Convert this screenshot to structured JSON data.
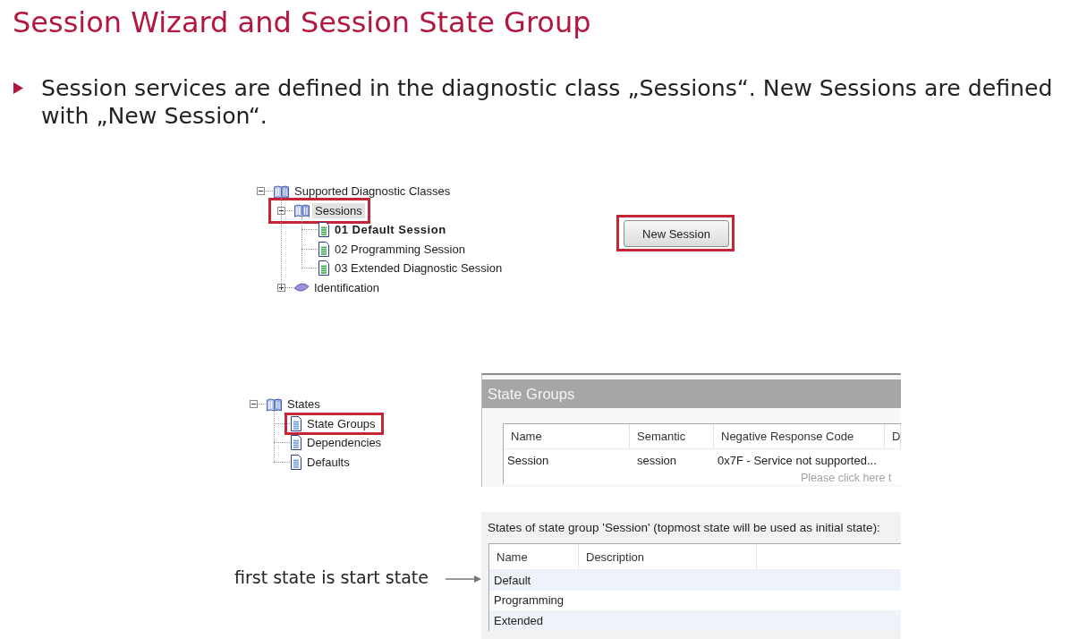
{
  "slide": {
    "title": "Session Wizard and Session State Group",
    "bullets": [
      "Session services are defined in the diagnostic class „Sessions“. New Sessions are defined with „New Session“."
    ]
  },
  "class_tree": {
    "items": [
      {
        "label": "Supported Diagnostic Classes",
        "kind": "folder",
        "expanded": true,
        "selected": false,
        "marked": false,
        "children": [
          {
            "label": "Sessions",
            "kind": "folder",
            "expanded": true,
            "selected": true,
            "marked": true,
            "children": [
              {
                "label": "01 Default Session",
                "kind": "session",
                "bold": true,
                "selected": false,
                "marked": false
              },
              {
                "label": "02 Programming Session",
                "kind": "session",
                "bold": false,
                "selected": false,
                "marked": false
              },
              {
                "label": "03 Extended Diagnostic Session",
                "kind": "session",
                "bold": false,
                "selected": false,
                "marked": false
              }
            ]
          },
          {
            "label": "Identification",
            "kind": "service",
            "expanded": false,
            "selected": false,
            "marked": false
          }
        ]
      }
    ]
  },
  "new_session_button": {
    "label": "New Session",
    "marked": true
  },
  "states_tree": {
    "items": [
      {
        "label": "States",
        "kind": "folder",
        "expanded": true,
        "selected": false,
        "marked": false,
        "children": [
          {
            "label": "State Groups",
            "kind": "page",
            "selected": false,
            "marked": true
          },
          {
            "label": "Dependencies",
            "kind": "page",
            "selected": false,
            "marked": false
          },
          {
            "label": "Defaults",
            "kind": "page",
            "selected": false,
            "marked": false
          }
        ]
      }
    ]
  },
  "state_groups_panel": {
    "title": "State Groups",
    "table": {
      "columns": [
        "Name",
        "Semantic",
        "Negative Response Code",
        "D"
      ],
      "rows": [
        [
          "Session",
          "session",
          "0x7F - Service not supported..."
        ]
      ]
    },
    "hint": "Please click here t"
  },
  "annotation": {
    "text": "first state is start state"
  },
  "states_panel": {
    "caption": "States of state group 'Session' (topmost state will be used as initial state):",
    "table": {
      "columns": [
        "Name",
        "Description"
      ],
      "rows": [
        [
          "Default"
        ],
        [
          "Programming"
        ],
        [
          "Extended"
        ]
      ]
    }
  }
}
